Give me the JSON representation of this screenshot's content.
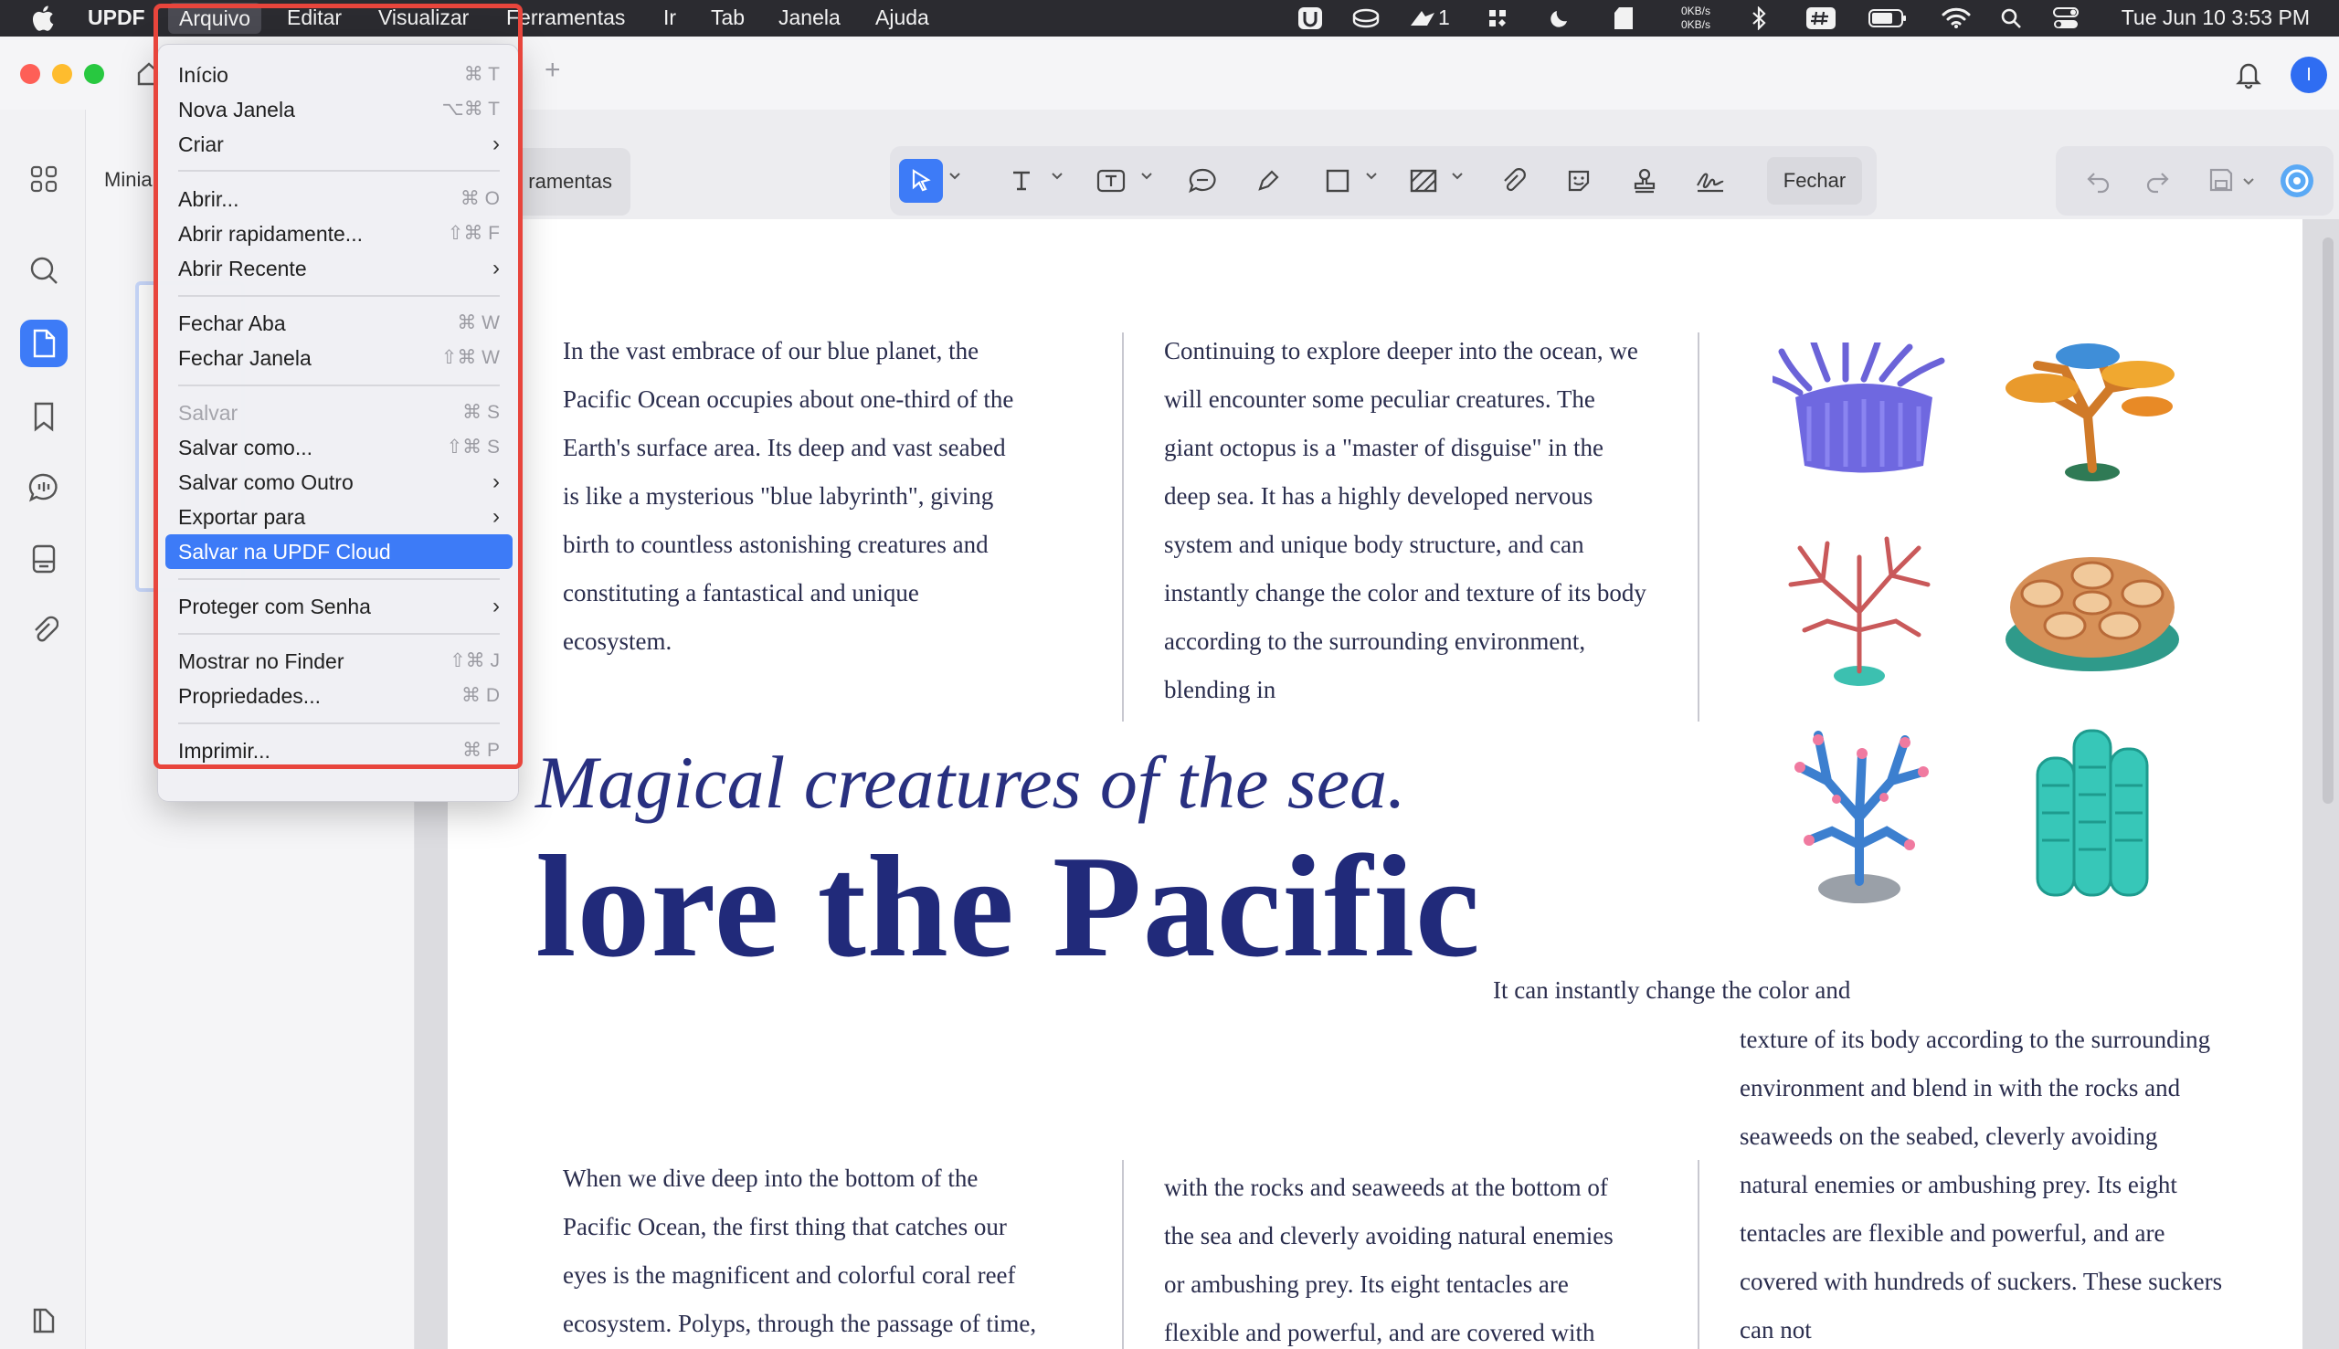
{
  "menubar": {
    "app_name": "UPDF",
    "items": [
      "Arquivo",
      "Editar",
      "Visualizar",
      "Ferramentas",
      "Ir",
      "Tab",
      "Janela",
      "Ajuda"
    ],
    "active_item": "Arquivo",
    "net_up": "0KB/s",
    "net_down": "0KB/s",
    "badge_count": "1",
    "clock": "Tue Jun 10  3:53 PM"
  },
  "window": {
    "avatar_letter": "I",
    "thumbnail_label": "Minia",
    "tools_chip": "ramentas",
    "close_button": "Fechar"
  },
  "file_menu": {
    "items": [
      {
        "label": "Início",
        "shortcut": "⌘ T"
      },
      {
        "label": "Nova Janela",
        "shortcut": "⌥⌘ T"
      },
      {
        "label": "Criar",
        "submenu": "›"
      },
      {
        "label": "Abrir...",
        "shortcut": "⌘ O"
      },
      {
        "label": "Abrir rapidamente...",
        "shortcut": "⇧⌘ F"
      },
      {
        "label": "Abrir Recente",
        "submenu": "›"
      },
      {
        "label": "Fechar Aba",
        "shortcut": "⌘ W"
      },
      {
        "label": "Fechar Janela",
        "shortcut": "⇧⌘ W"
      },
      {
        "label": "Salvar",
        "shortcut": "⌘ S",
        "disabled": true
      },
      {
        "label": "Salvar como...",
        "shortcut": "⇧⌘ S"
      },
      {
        "label": "Salvar como Outro",
        "submenu": "›"
      },
      {
        "label": "Exportar para",
        "submenu": "›"
      },
      {
        "label": "Salvar na UPDF Cloud",
        "highlight": true
      },
      {
        "label": "Proteger com Senha",
        "submenu": "›"
      },
      {
        "label": "Mostrar no Finder",
        "shortcut": "⇧⌘ J"
      },
      {
        "label": "Propriedades...",
        "shortcut": "⌘ D"
      },
      {
        "label": "Imprimir...",
        "shortcut": "⌘ P"
      }
    ]
  },
  "document": {
    "col1_top": "In the vast embrace of our blue planet, the Pacific Ocean occupies about one-third of the Earth's surface area. Its deep and vast seabed is like a mysterious \"blue labyrinth\", giving birth to countless astonishing creatures and constituting a fantastical and unique ecosystem.",
    "col2_top": "Continuing to explore deeper into the ocean, we will encounter some peculiar creatures. The giant octopus is a \"master of disguise\" in the deep sea. It has a highly developed nervous system and unique body structure, and can instantly change the color and texture of its body according to the surrounding environment, blending in",
    "italic_title": "Magical creatures of the sea.",
    "big_title": "lore the Pacific",
    "right_lead": "It can instantly change the color and",
    "right_col": "texture of its body according to the surrounding environment and blend in with the rocks and seaweeds on the seabed, cleverly avoiding natural enemies or ambushing prey. Its eight tentacles are flexible and powerful, and are covered with hundreds of suckers. These suckers can not",
    "col1_bottom": "When we dive deep into the bottom of the Pacific Ocean, the first thing that catches our eyes is the magnificent and colorful coral reef ecosystem. Polyps, through the passage of time, have built up a vast and",
    "col2_bottom": "with the rocks and seaweeds at the bottom of the sea and cleverly avoiding natural enemies or ambushing prey. Its eight tentacles are flexible and powerful, and are covered with hundreds of suckers. These"
  },
  "colors": {
    "accent": "#3d7bf7",
    "menu_outline": "#e8453c",
    "title_blue": "#212a7a"
  }
}
